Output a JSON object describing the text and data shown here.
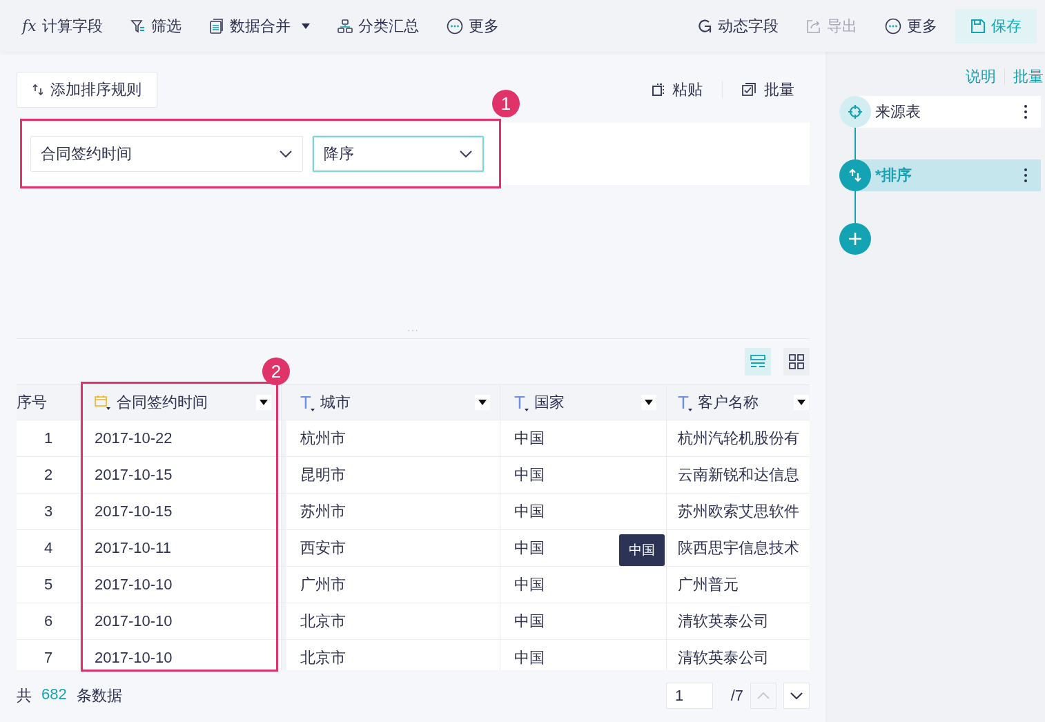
{
  "toolbar": {
    "left": [
      {
        "kind": "fx",
        "icon_text": "fx",
        "label": "计算字段",
        "dropdown": false
      },
      {
        "kind": "filter",
        "label": "筛选",
        "dropdown": false
      },
      {
        "kind": "merge",
        "label": "数据合并",
        "dropdown": true
      },
      {
        "kind": "group",
        "label": "分类汇总",
        "dropdown": false
      },
      {
        "kind": "more",
        "label": "更多",
        "dropdown": false
      }
    ],
    "right": [
      {
        "kind": "dynamic",
        "label": "动态字段",
        "disabled": false,
        "primary": false
      },
      {
        "kind": "export",
        "label": "导出",
        "disabled": true,
        "primary": false
      },
      {
        "kind": "more",
        "label": "更多",
        "disabled": false,
        "primary": false
      },
      {
        "kind": "save",
        "label": "保存",
        "disabled": false,
        "primary": true
      }
    ]
  },
  "sort_panel": {
    "add_button": "添加排序规则",
    "actions": [
      {
        "kind": "paste",
        "label": "粘贴"
      },
      {
        "kind": "batch",
        "label": "批量"
      }
    ],
    "rules": [
      {
        "field": "合同签约时间",
        "order": "降序",
        "order_focused": true
      }
    ],
    "splitter": "···"
  },
  "view_toggles": [
    {
      "kind": "rows",
      "selected": true
    },
    {
      "kind": "grid",
      "selected": false
    }
  ],
  "table": {
    "columns": [
      {
        "kind": "index",
        "label": "序号"
      },
      {
        "kind": "date",
        "label": "合同签约时间"
      },
      {
        "kind": "text",
        "type_glyph": "T",
        "label": "城市"
      },
      {
        "kind": "text",
        "type_glyph": "T",
        "label": "国家"
      },
      {
        "kind": "text",
        "type_glyph": "T",
        "label": "客户名称"
      }
    ],
    "rows": [
      {
        "cells": [
          "1",
          "2017-10-22",
          "杭州市",
          "中国",
          "杭州汽轮机股份有"
        ]
      },
      {
        "cells": [
          "2",
          "2017-10-15",
          "昆明市",
          "中国",
          "云南新锐和达信息"
        ]
      },
      {
        "cells": [
          "3",
          "2017-10-15",
          "苏州市",
          "中国",
          "苏州欧索艾思软件"
        ]
      },
      {
        "cells": [
          "4",
          "2017-10-11",
          "西安市",
          "中国",
          "陕西思宇信息技术"
        ],
        "tooltip": "中国"
      },
      {
        "cells": [
          "5",
          "2017-10-10",
          "广州市",
          "中国",
          "广州普元"
        ]
      },
      {
        "cells": [
          "6",
          "2017-10-10",
          "北京市",
          "中国",
          "清软英泰公司"
        ]
      },
      {
        "cells": [
          "7",
          "2017-10-10",
          "北京市",
          "中国",
          "清软英泰公司"
        ]
      }
    ]
  },
  "footer": {
    "prefix": "共",
    "count": "682",
    "suffix": "条数据",
    "page": "1",
    "pages": "/7",
    "prev_disabled": true,
    "next_disabled": false
  },
  "side_panel": {
    "links": [
      "说明",
      "批量"
    ],
    "steps": [
      {
        "kind": "source",
        "label": "来源表",
        "selected": false
      },
      {
        "kind": "sort",
        "label": "*排序",
        "selected": true
      }
    ]
  },
  "annotations": [
    {
      "number": "1"
    },
    {
      "number": "2"
    }
  ]
}
